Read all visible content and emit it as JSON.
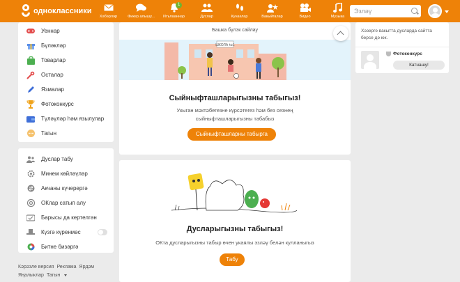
{
  "topbar": {
    "logo_text": "одноклассники",
    "nav": [
      {
        "label": "Хәбәрләр",
        "icon": "envelope-icon"
      },
      {
        "label": "Фикер алышу...",
        "icon": "chat-icon"
      },
      {
        "label": "Игълааннар",
        "icon": "bell-icon",
        "badge": "1"
      },
      {
        "label": "Дуслар",
        "icon": "friends-icon"
      },
      {
        "label": "Кунаклар",
        "icon": "footprints-icon"
      },
      {
        "label": "Вакыйгалар",
        "icon": "events-icon"
      },
      {
        "label": "Видео",
        "icon": "video-camera-icon"
      },
      {
        "label": "Музыка",
        "icon": "music-note-icon"
      }
    ],
    "search_placeholder": "Эзләү"
  },
  "sidebar": {
    "items": [
      {
        "label": "Уеннар",
        "icon": "gamepad-icon",
        "color": "#e34d4d"
      },
      {
        "label": "Бүләкләр",
        "icon": "gift-icon",
        "color": "#5b8ee6"
      },
      {
        "label": "Товарлар",
        "icon": "shopping-bag-icon",
        "color": "#4caf50"
      },
      {
        "label": "Осталар",
        "icon": "tools-icon",
        "color": "#e34d4d"
      },
      {
        "label": "Язмалар",
        "icon": "pen-icon",
        "color": "#3f6fd8"
      },
      {
        "label": "Фотоконкурс",
        "icon": "trophy-icon",
        "color": "#f0a31b"
      },
      {
        "label": "Түләүләр һәм язылулар",
        "icon": "wallet-icon",
        "color": "#3f6fd8"
      },
      {
        "label": "Тагын",
        "icon": "more-icon",
        "color": "#f5c16c"
      }
    ],
    "settings": [
      {
        "label": "Дуслар табу",
        "icon": "people-icon"
      },
      {
        "label": "Минем көйләүләр",
        "icon": "gear-icon"
      },
      {
        "label": "Акчаны күчерергә",
        "icon": "money-transfer-icon"
      },
      {
        "label": "ОКлар сатып алу",
        "icon": "ok-coin-icon"
      },
      {
        "label": "Барысы да кертелгән",
        "icon": "all-inclusive-icon"
      },
      {
        "label": "Күзгә күренмәс",
        "icon": "invisible-hat-icon"
      },
      {
        "label": "Битне бизәргә",
        "icon": "palette-icon"
      }
    ],
    "footer": [
      "Кәрәзле версия",
      "Реклама",
      "Ярдәм",
      "Яңалыклар",
      "Тагын"
    ]
  },
  "main": {
    "card1": {
      "skip": "Башка бүлэк сайлау",
      "title": "Сыйныфташларыгызны табыгыз!",
      "text": "Укыган мәктәбегезне күрсәтегез һәм без сезнең сыйныфташларыгызны табабыз",
      "button": "Сыйныфташларны табырга",
      "sign_text": "ШКОЛА №1"
    },
    "card2": {
      "title": "Дусларыгызны табыгыз!",
      "text": "ОКта дусларыгызны табыр өчен укаялы эзләү белән кулланыгыз",
      "button": "Табу"
    }
  },
  "right": {
    "hint": "Хәзерге вакытта дусларда сайтта берсе дә юк.",
    "contest_name": "Фотоконкурс",
    "join_button": "Катнашу!"
  },
  "colors": {
    "accent": "#ee8208",
    "page_bg": "#ebebeb",
    "hero_bg": "#e3f3fb"
  }
}
